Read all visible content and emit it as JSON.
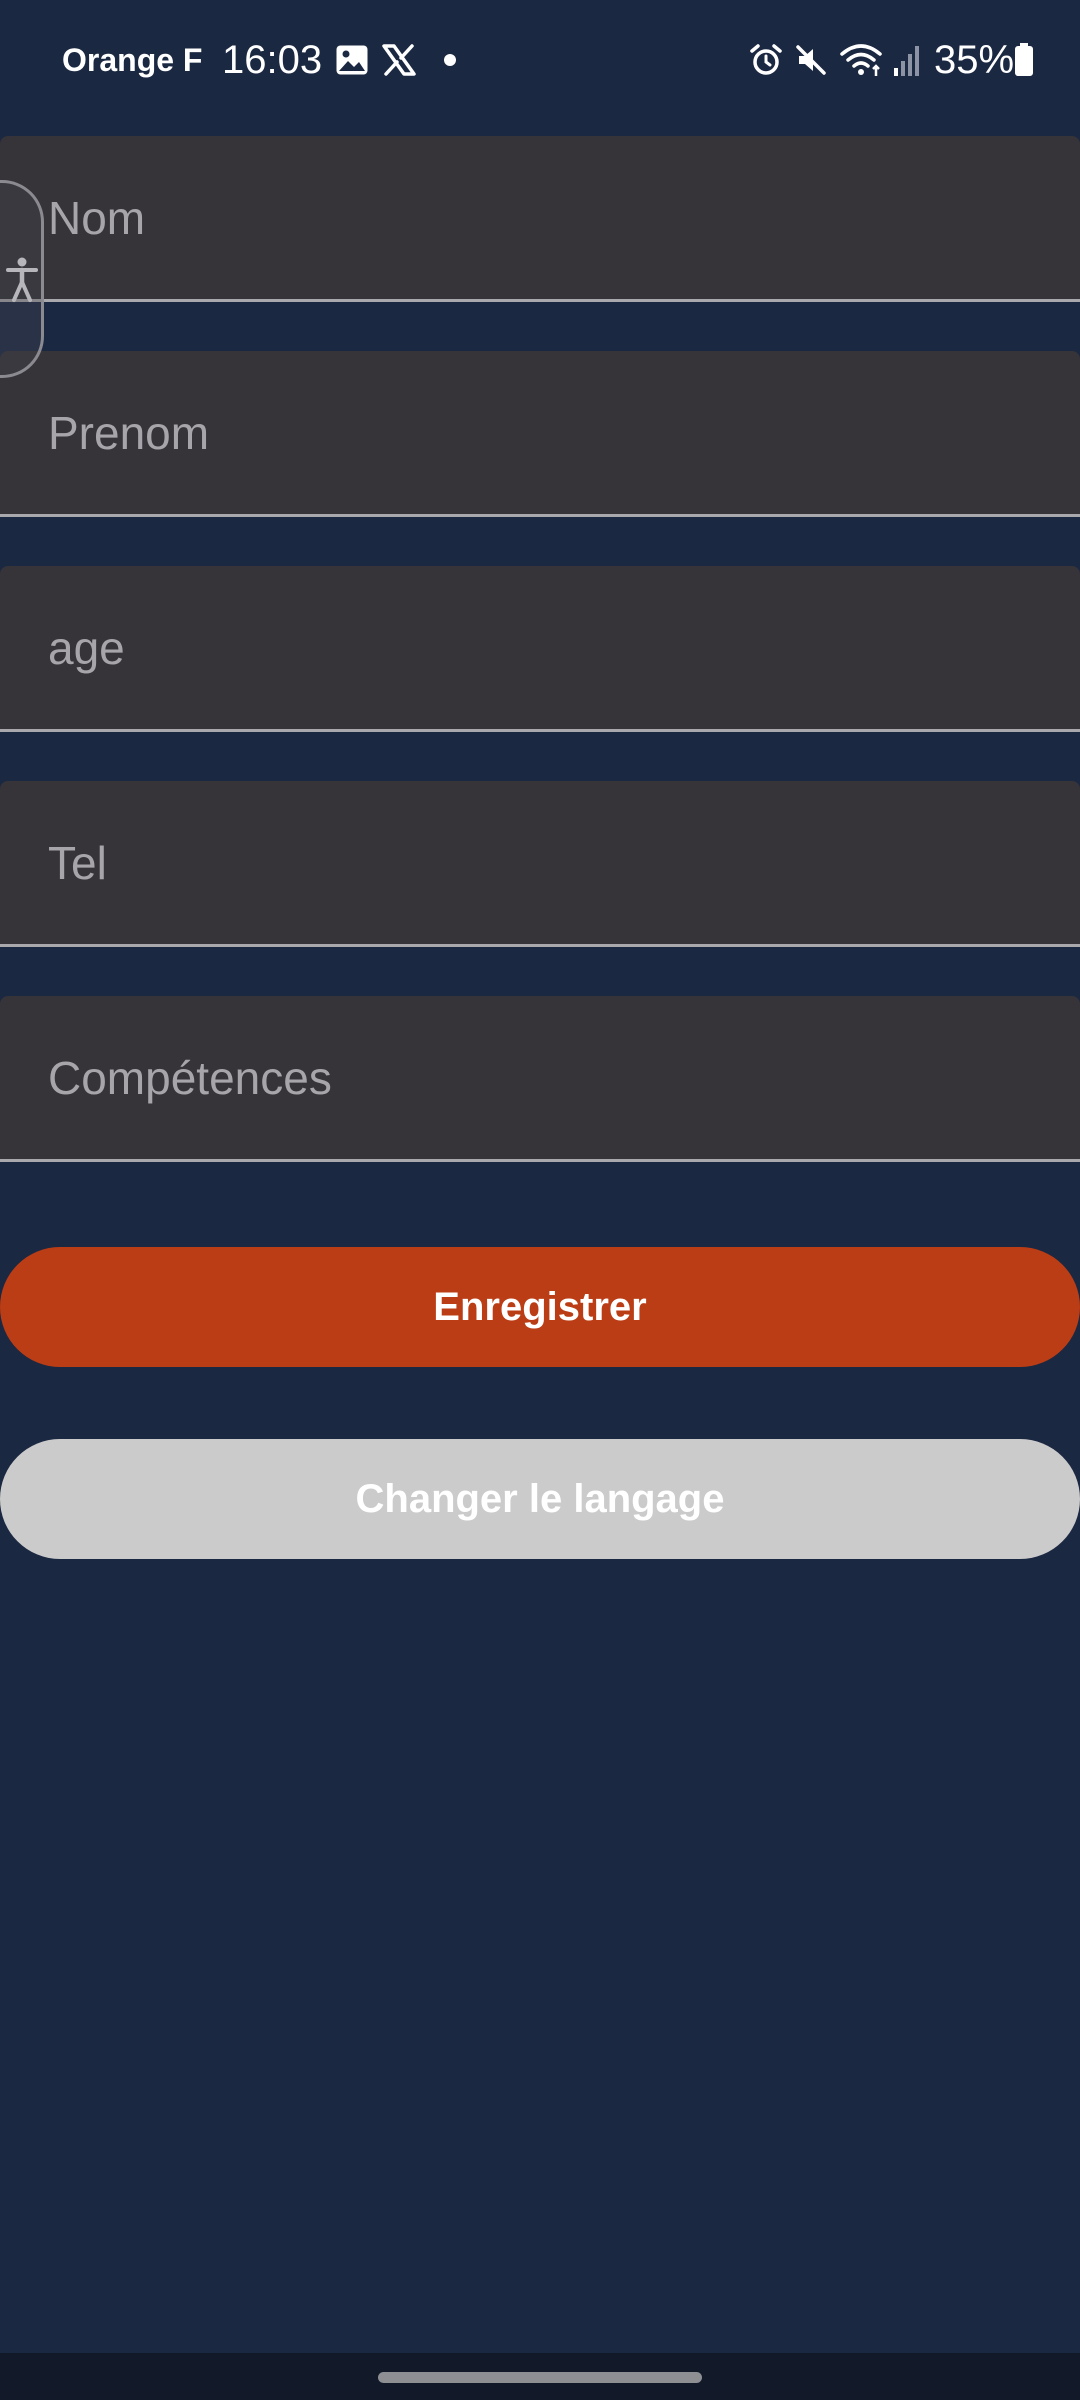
{
  "status_bar": {
    "carrier": "Orange F",
    "time": "16:03",
    "battery": "35%",
    "icons": [
      "gallery-icon",
      "x-logo-icon",
      "notification-dot-icon",
      "alarm-icon",
      "mute-icon",
      "wifi-icon",
      "signal-icon",
      "battery-icon"
    ]
  },
  "form": {
    "fields": [
      {
        "placeholder": "Nom",
        "value": ""
      },
      {
        "placeholder": "Prenom",
        "value": ""
      },
      {
        "placeholder": "age",
        "value": ""
      },
      {
        "placeholder": "Tel",
        "value": ""
      },
      {
        "placeholder": "Compétences",
        "value": ""
      }
    ],
    "save_label": "Enregistrer",
    "language_label": "Changer le langage"
  },
  "accessibility": {
    "icon": "accessibility-icon"
  },
  "colors": {
    "background": "#1b2842",
    "field_bg": "#363439",
    "save_button": "#bb3d15",
    "language_button": "#cbcbcb"
  }
}
